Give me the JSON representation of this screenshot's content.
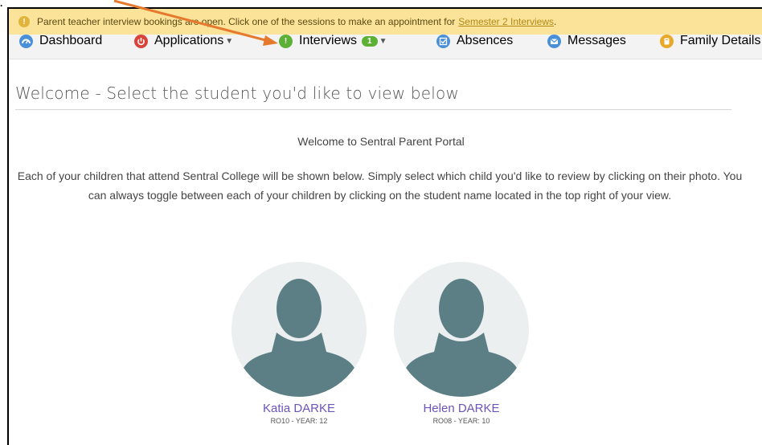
{
  "notice": {
    "text": "Parent teacher interview bookings are open. Click one of the sessions to make an appointment for",
    "link": "Semester 2 Interviews",
    "tail": "."
  },
  "nav": {
    "items": [
      {
        "label": "Dashboard",
        "icon": "dashboard-icon",
        "color": "#4a90d9"
      },
      {
        "label": "Applications",
        "icon": "power-icon",
        "color": "#d9443a",
        "dropdown": true
      },
      {
        "label": "Interviews",
        "icon": "alert-icon",
        "color": "#5cb034",
        "badge": "1",
        "dropdown": true
      },
      {
        "label": "Absences",
        "icon": "check-icon",
        "color": "#4a90d9"
      },
      {
        "label": "Messages",
        "icon": "envelope-icon",
        "color": "#4a90d9"
      },
      {
        "label": "Family Details",
        "icon": "book-icon",
        "color": "#e8a82a"
      }
    ]
  },
  "main": {
    "title": "Welcome - Select the student you'd like to view below",
    "welcome_heading": "Welcome to Sentral Parent Portal",
    "intro": "Each of your children that attend Sentral College will be shown below. Simply select which child you'd like to review by clicking on their photo. You can always toggle between each of your children by clicking on the student name located in the top right of your view."
  },
  "students": [
    {
      "name": "Katia DARKE",
      "info": "RO10 - YEAR: 12"
    },
    {
      "name": "Helen DARKE",
      "info": "RO08 - YEAR: 10"
    }
  ],
  "colors": {
    "notice_bg": "#fbe39a",
    "nav_bg": "#f3f3f3",
    "student_name": "#6a55b8",
    "silhouette": "#5c7f86",
    "annotation_arrow": "#e57a2e"
  }
}
